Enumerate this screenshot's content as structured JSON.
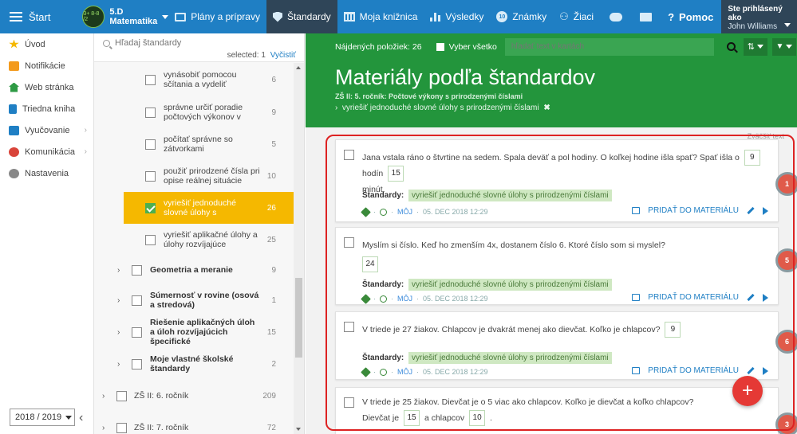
{
  "topbar": {
    "start": "Štart",
    "class_name": "5.D",
    "class_subject": "Matematika",
    "avatar_text": "3+ 8-8 /2",
    "nav": [
      {
        "label": "Plány a prípravy"
      },
      {
        "label": "Štandardy"
      },
      {
        "label": "Moja knižnica"
      },
      {
        "label": "Výsledky"
      },
      {
        "label": "Známky"
      },
      {
        "label": "Žiaci"
      }
    ],
    "help": "Pomoc",
    "user_line1": "Ste prihlásený ako",
    "user_line2": "John Williams"
  },
  "leftnav": {
    "items": [
      {
        "label": "Úvod",
        "color": "#f5b800"
      },
      {
        "label": "Notifikácie",
        "color": "#f39a1d"
      },
      {
        "label": "Web stránka",
        "color": "#2e9a44"
      },
      {
        "label": "Triedna kniha",
        "color": "#1f7fc4"
      },
      {
        "label": "Vyučovanie",
        "color": "#1f7fc4"
      },
      {
        "label": "Komunikácia",
        "color": "#d9443a"
      },
      {
        "label": "Nastavenia",
        "color": "#888888"
      }
    ],
    "year": "2018 / 2019"
  },
  "standards": {
    "search_placeholder": "Hľadaj štandardy",
    "selected_label": "selected: 1",
    "clear_label": "Vyčistiť",
    "leaves": [
      {
        "text": "vynásobiť pomocou sčítania a vydeliť pomocou postupu",
        "count": "6"
      },
      {
        "text": "správne určiť poradie počtových výkonov v úlohe",
        "count": "9"
      },
      {
        "text": "počítať správne so zátvorkami",
        "count": "5"
      },
      {
        "text": "použiť prirodzené čísla pri opise reálnej situácie",
        "count": "10"
      },
      {
        "text": "vyriešiť jednoduché slovné úlohy s prirodzenými číslami",
        "count": "26"
      },
      {
        "text": "vyriešiť aplikačné úlohy a úlohy rozvíjajúce špecifické",
        "count": "25"
      }
    ],
    "categories": [
      {
        "text": "Geometria a meranie",
        "count": "9"
      },
      {
        "text": "Súmernosť v rovine (osová a stredová)",
        "count": "1"
      },
      {
        "text": "Riešenie aplikačných úloh a úloh rozvíjajúcich špecifické",
        "count": "15"
      },
      {
        "text": "Moje vlastné školské štandardy",
        "count": "2"
      }
    ],
    "grades": [
      {
        "text": "ZŠ II: 6. ročník",
        "count": "209"
      },
      {
        "text": "ZŠ II: 7. ročník",
        "count": "72"
      }
    ]
  },
  "main": {
    "found_label": "Nájdených položiek: 26",
    "select_all": "Vyber všetko",
    "filter_placeholder": "hľadať text v kartách",
    "title": "Materiály podľa štandardov",
    "subtitle": "ZŠ II: 5. ročník: Počtové výkony s prirodzenými číslami",
    "crumb": "vyriešiť jednoduché slovné úlohy s prirodzenými číslami",
    "zoom_text": "Zväčšiť text",
    "std_label": "Štandardy:",
    "std_tag": "vyriešiť jednoduché slovné úlohy s prirodzenými číslami",
    "meta_moj": "MÔJ",
    "meta_date": "05. DEC 2018 12:29",
    "add_label": "PRIDAŤ DO MATERIÁLU",
    "cards": [
      {
        "q1": "Jana vstala ráno o štvrtine na sedem. Spala deväť a pol hodiny. O koľkej hodine išla spať? Spať išla o",
        "a1": "9",
        "q2": "hodín",
        "a2": "15",
        "q3": "minút.",
        "badge": "1"
      },
      {
        "q1": "Myslím si číslo. Keď ho zmenším 4x, dostanem číslo 6. Ktoré číslo som si myslel?",
        "a1": "24",
        "badge": "5"
      },
      {
        "q1": "V triede je 27 žiakov. Chlapcov je dvakrát menej ako dievčat. Koľko je chlapcov?",
        "a1": "9",
        "badge": "6"
      },
      {
        "q1": "V triede je 25 žiakov. Dievčat je o 5 viac ako chlapcov. Koľko je dievčat a koľko chlapcov?",
        "q2": "Dievčat je",
        "a1": "15",
        "q3": "a chlapcov",
        "a2": "10",
        "q4": ".",
        "badge": "3"
      }
    ],
    "fab": "+"
  }
}
